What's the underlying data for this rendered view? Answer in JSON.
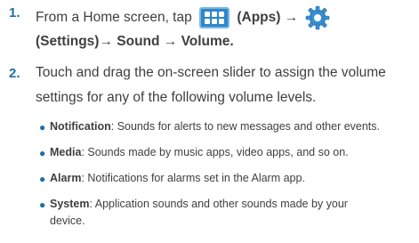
{
  "steps": [
    {
      "number": "1.",
      "line1_prefix": "From a Home screen, tap",
      "apps_label": "(Apps) →",
      "line2": "(Settings)→ Sound → Volume."
    },
    {
      "number": "2.",
      "line1": "Touch and drag the on-screen slider to assign the volume",
      "line2": "settings for any of the following volume levels."
    }
  ],
  "bullets": [
    {
      "term": "Notification",
      "text": ": Sounds for alerts to new messages and other events."
    },
    {
      "term": "Media",
      "text": ": Sounds made by music apps, video apps, and so on."
    },
    {
      "term": "Alarm",
      "text": ": Notifications for alarms set in the Alarm app."
    },
    {
      "term": "System",
      "text": ": Application sounds and other sounds made by your"
    }
  ],
  "bullet_continuation": "device.",
  "icons": {
    "apps": "apps-grid-icon",
    "settings": "gear-icon"
  },
  "colors": {
    "accent": "#1f6fa9",
    "text": "#3f3f3f",
    "apps_bg": "#2e86c8"
  }
}
